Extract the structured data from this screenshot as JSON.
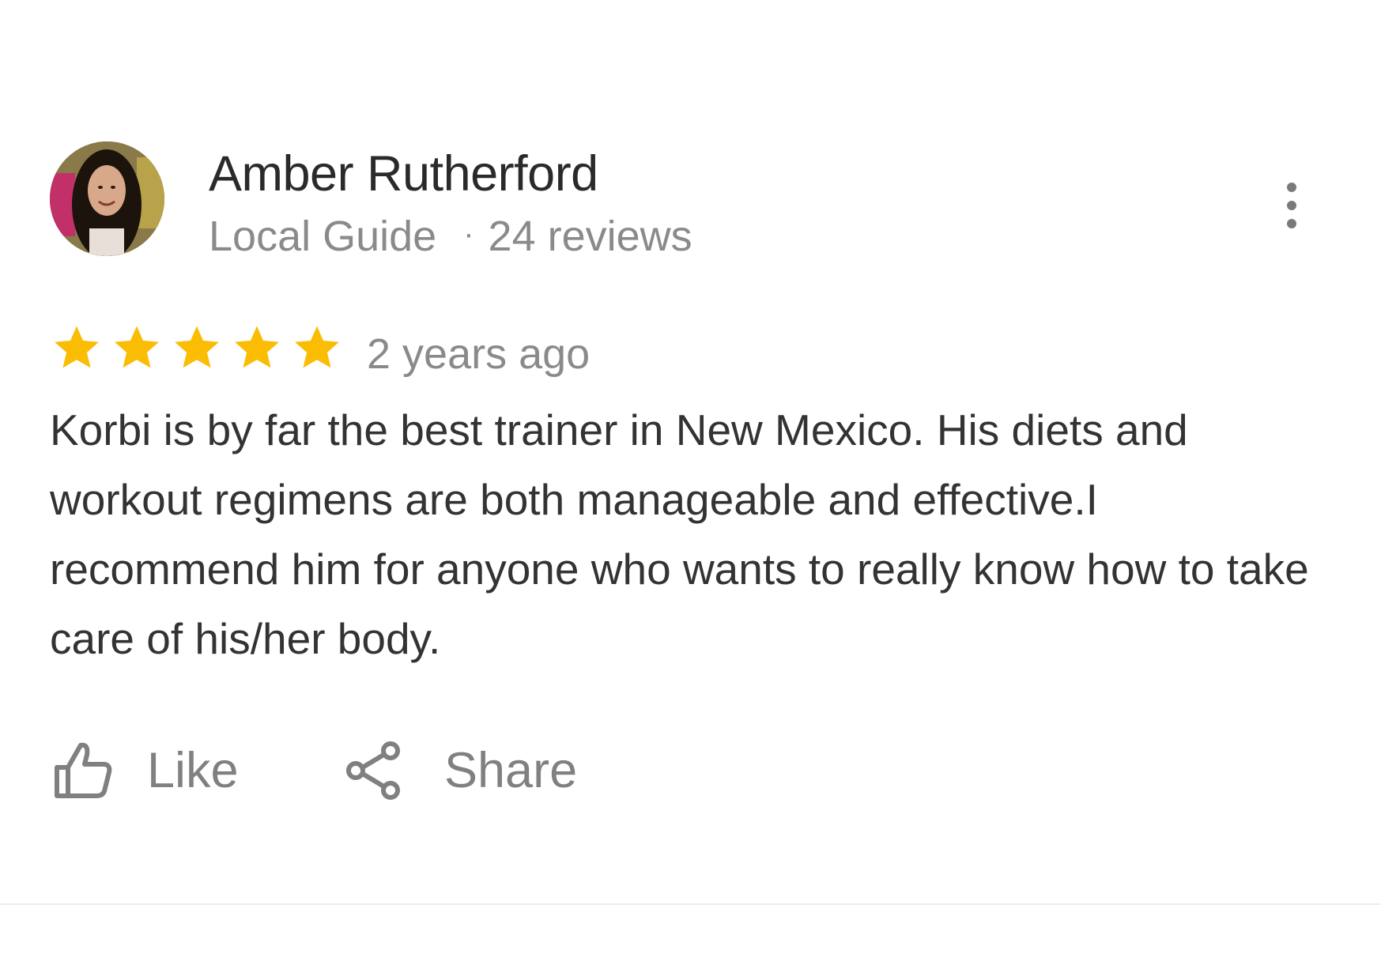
{
  "review": {
    "author": {
      "name": "Amber Rutherford",
      "badge": "Local Guide",
      "separator": "·",
      "review_count": "24 reviews",
      "avatar_icon": "user-avatar-photo"
    },
    "menu_icon": "more-vertical-icon",
    "rating": {
      "value": 5,
      "max": 5,
      "star_color": "#FBBC04"
    },
    "time": "2 years ago",
    "text": "Korbi is by far the best trainer in New Mexico. His diets and workout regimens are both manageable and effective.I recommend him for anyone who wants to really know how to take care of his/her body.",
    "actions": {
      "like": {
        "label": "Like",
        "icon": "thumb-up-icon"
      },
      "share": {
        "label": "Share",
        "icon": "share-icon"
      }
    }
  },
  "colors": {
    "name_text": "#2a2a2a",
    "meta_text": "#8a8a8a",
    "body_text": "#333333",
    "action_text": "#808080"
  }
}
